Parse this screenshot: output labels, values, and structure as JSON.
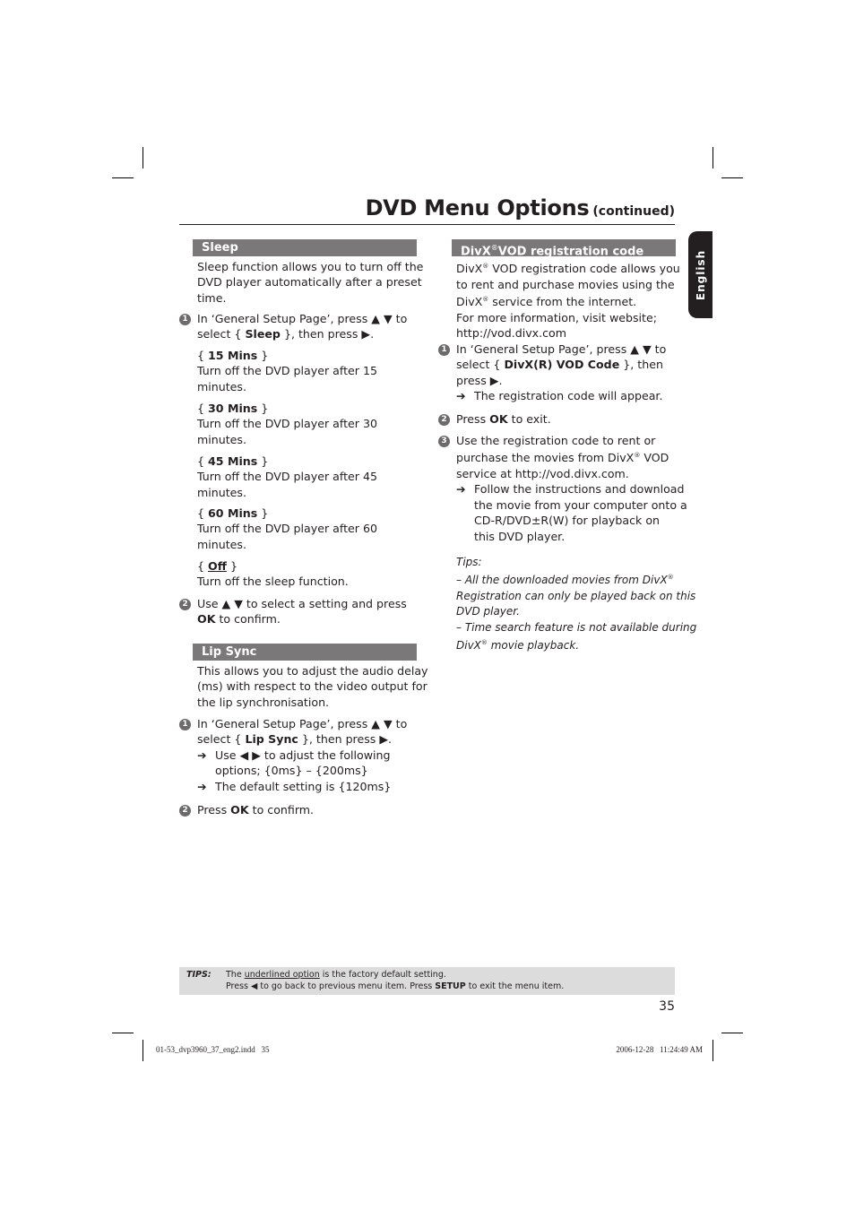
{
  "header": {
    "title": "DVD Menu Options",
    "subtitle": "(continued)"
  },
  "side_tab": {
    "label": "English"
  },
  "sleep": {
    "heading": "Sleep",
    "intro": [
      "Sleep function allows you to turn off the",
      "DVD player automatically after a preset",
      "time."
    ],
    "step1": {
      "number": "1",
      "line1_pre": "In ‘General Setup Page’, press ▲ ▼ to",
      "line2_pre": "select { ",
      "line2_bold": "Sleep",
      "line2_post": " }, then press ▶."
    },
    "options": [
      {
        "name": "15 Mins",
        "desc1": "Turn off the DVD player after 15",
        "desc2": "minutes."
      },
      {
        "name": "30 Mins",
        "desc1": "Turn off the DVD player after 30",
        "desc2": "minutes."
      },
      {
        "name": "45 Mins",
        "desc1": "Turn off the DVD player after 45",
        "desc2": "minutes."
      },
      {
        "name": "60 Mins",
        "desc1": "Turn off the DVD player after 60",
        "desc2": "minutes."
      },
      {
        "name": "Off",
        "desc1": "Turn off the sleep function.",
        "default": true
      }
    ],
    "step2": {
      "number": "2",
      "line1": "Use ▲ ▼ to select a setting and press",
      "line2_bold": "OK",
      "line2_post": " to confirm."
    }
  },
  "lip_sync": {
    "heading": "Lip Sync",
    "intro": [
      "This allows you to adjust the audio delay",
      "(ms) with respect to the video output for",
      "the lip synchronisation."
    ],
    "step1": {
      "number": "1",
      "line1": "In ‘General Setup Page’, press ▲ ▼ to",
      "line2_pre": "select { ",
      "line2_bold": "Lip Sync",
      "line2_post": " }, then press ▶.",
      "sub1a": "Use ◀ ▶ to adjust the following",
      "sub1b": "options; {0ms} – {200ms}",
      "sub2": "The default setting is {120ms}"
    },
    "step2": {
      "number": "2",
      "pre": "Press ",
      "bold": "OK",
      "post": " to confirm."
    }
  },
  "divx": {
    "heading_pre": "DivX",
    "heading_post": "VOD registration code",
    "reg": "®",
    "intro1_pre": "DivX",
    "intro1_post": " VOD registration code allows you",
    "intro2": "to rent and purchase movies using the",
    "intro3_pre": "DivX",
    "intro3_post": " service from the internet.",
    "intro4": "For more information, visit website;",
    "intro5": "http://vod.divx.com",
    "step1": {
      "number": "1",
      "line1": "In ‘General Setup Page’, press ▲ ▼ to",
      "line2_pre": "select { ",
      "line2_bold": "DivX(R) VOD Code",
      "line2_post": " }, then",
      "line3": "press ▶.",
      "sub": "The registration code will appear."
    },
    "step2": {
      "number": "2",
      "pre": "Press ",
      "bold": "OK",
      "post": " to exit."
    },
    "step3": {
      "number": "3",
      "line1": "Use the registration code to rent or",
      "line2_pre": "purchase the movies from DivX",
      "line2_post": " VOD",
      "line3": "service at http://vod.divx.com.",
      "sub1": "Follow the instructions and download",
      "sub2": "the movie from your computer onto a",
      "sub3": "CD-R/DVD±R(W) for playback on",
      "sub4": "this DVD player."
    },
    "tips": {
      "label": "Tips:",
      "t1a": "– All the downloaded movies from DivX",
      "t1b": "Registration can only be played back on this",
      "t1c": "DVD player.",
      "t2a": "– Time search feature is not available during",
      "t2b_pre": "DivX",
      "t2b_post": " movie playback."
    }
  },
  "footer_tips": {
    "label": "TIPS:",
    "line1_pre": "The ",
    "line1_underlined": "underlined option",
    "line1_post": " is the factory default setting.",
    "line2_pre": "Press ◀ to go back to previous menu item. Press ",
    "line2_bold": "SETUP",
    "line2_post": " to exit the menu item."
  },
  "page_number": "35",
  "slug": {
    "file": "01-53_dvp3960_37_eng2.indd   35",
    "timestamp": "2006-12-28   11:24:49 AM"
  },
  "arrow_glyph": "➔"
}
